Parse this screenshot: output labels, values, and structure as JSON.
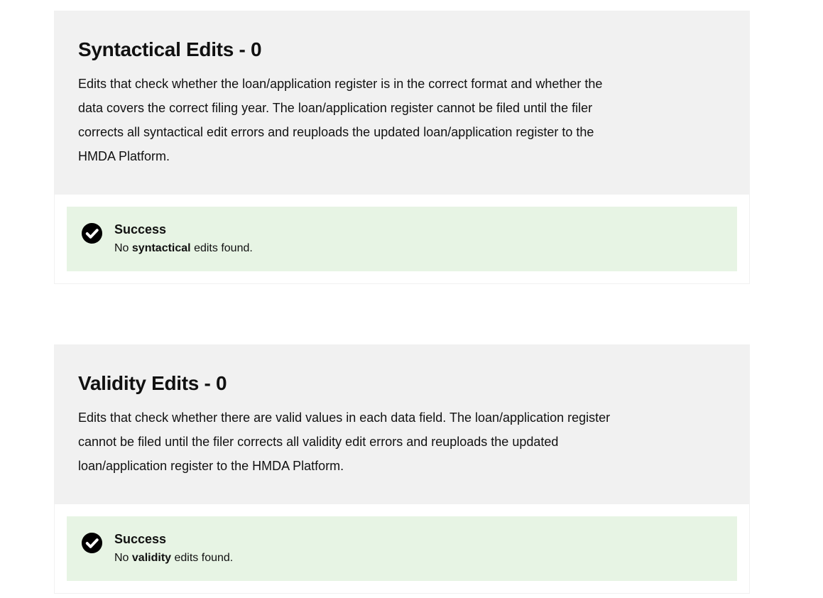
{
  "sections": [
    {
      "title": "Syntactical Edits - 0",
      "description": "Edits that check whether the loan/application register is in the correct format and whether the data covers the correct filing year. The loan/application register cannot be filed until the filer corrects all syntactical edit errors and reuploads the updated loan/application register to the HMDA Platform.",
      "alert": {
        "icon": "check-circle-icon",
        "heading": "Success",
        "text_prefix": "No",
        "text_bold": "syntactical",
        "text_suffix": "edits found."
      }
    },
    {
      "title": "Validity Edits - 0",
      "description": "Edits that check whether there are valid values in each data field. The loan/application register cannot be filed until the filer corrects all validity edit errors and reuploads the updated loan/application register to the HMDA Platform.",
      "alert": {
        "icon": "check-circle-icon",
        "heading": "Success",
        "text_prefix": "No",
        "text_bold": "validity",
        "text_suffix": "edits found."
      }
    }
  ],
  "colors": {
    "header_bg": "#f1f1f1",
    "success_bg": "#e7f4e4",
    "text": "#111111"
  }
}
